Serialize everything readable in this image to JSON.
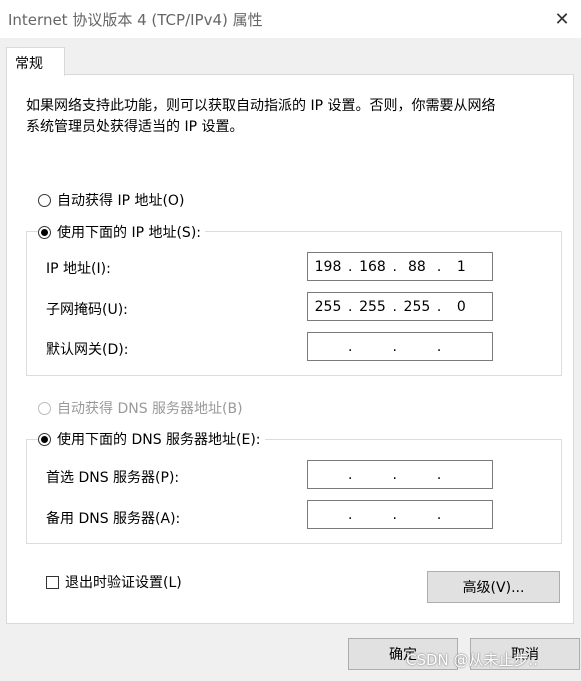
{
  "window": {
    "title": "Internet 协议版本 4 (TCP/IPv4) 属性",
    "close_glyph": "✕"
  },
  "tabs": [
    {
      "label": "常规"
    }
  ],
  "description": {
    "line1": "如果网络支持此功能，则可以获取自动指派的 IP 设置。否则，你需要从网络",
    "line2": "系统管理员处获得适当的 IP 设置。"
  },
  "ip_section": {
    "auto_label": "自动获得 IP 地址(O)",
    "manual_label": "使用下面的 IP 地址(S):",
    "selected": "manual",
    "fields": [
      {
        "label": "IP 地址(I):",
        "octets": [
          "198",
          "168",
          "88",
          "1"
        ]
      },
      {
        "label": "子网掩码(U):",
        "octets": [
          "255",
          "255",
          "255",
          "0"
        ]
      },
      {
        "label": "默认网关(D):",
        "octets": [
          "",
          "",
          "",
          ""
        ]
      }
    ]
  },
  "dns_section": {
    "auto_label": "自动获得 DNS 服务器地址(B)",
    "manual_label": "使用下面的 DNS 服务器地址(E):",
    "selected": "manual",
    "fields": [
      {
        "label": "首选 DNS 服务器(P):",
        "octets": [
          "",
          "",
          "",
          ""
        ]
      },
      {
        "label": "备用 DNS 服务器(A):",
        "octets": [
          "",
          "",
          "",
          ""
        ]
      }
    ]
  },
  "validate_checkbox": {
    "label": "退出时验证设置(L)",
    "checked": false
  },
  "buttons": {
    "advanced": "高级(V)...",
    "ok": "确定",
    "cancel": "取消"
  },
  "watermark": "CSDN @从未止步.."
}
